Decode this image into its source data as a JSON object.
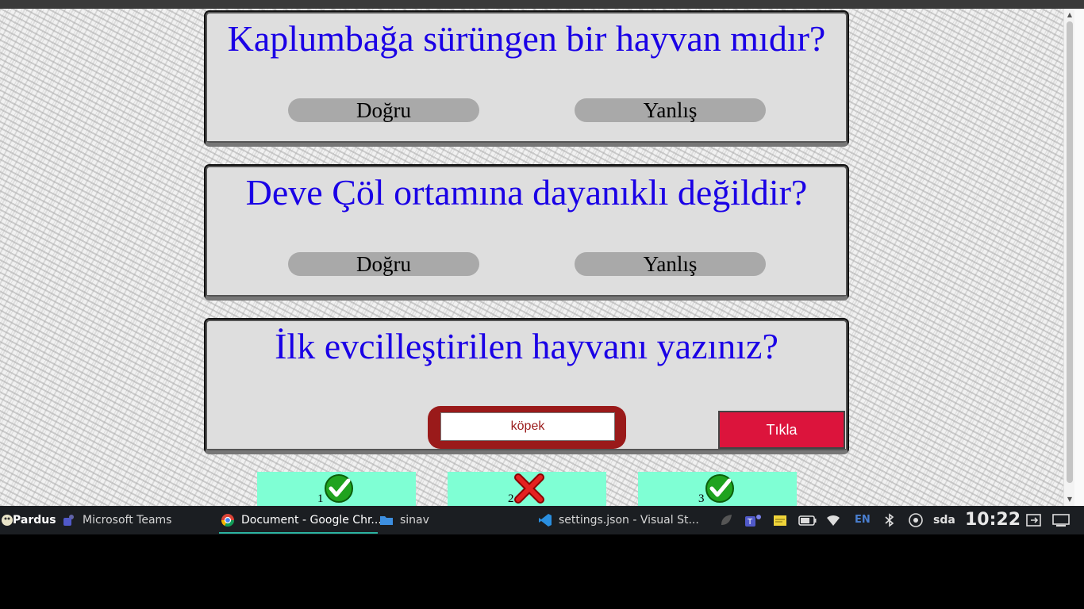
{
  "questions": [
    {
      "text": "Kaplumbağa sürüngen bir hayvan mıdır?",
      "true_label": "Doğru",
      "false_label": "Yanlış"
    },
    {
      "text": "Deve Çöl ortamına dayanıklı değildir?",
      "true_label": "Doğru",
      "false_label": "Yanlış"
    },
    {
      "text": "İlk evcilleştirilen hayvanı yazınız?",
      "answer_value": "köpek",
      "submit_label": "Tıkla"
    }
  ],
  "results": [
    {
      "number": "1",
      "icon": "check-icon",
      "status": "correct"
    },
    {
      "number": "2",
      "icon": "cross-icon",
      "status": "wrong"
    },
    {
      "number": "3",
      "icon": "check-icon",
      "status": "correct"
    }
  ],
  "colors": {
    "question_text": "#1a00e6",
    "card_bg": "#dedede",
    "answer_button": "#a9a9a9",
    "input_frame": "#9a1a1a",
    "submit_button": "#dc143c",
    "result_box": "#7fffd4"
  },
  "taskbar": {
    "start_label": "Pardus",
    "apps": [
      {
        "label": "Microsoft Teams",
        "icon": "teams-icon"
      },
      {
        "label": "Document - Google Chr...",
        "icon": "chrome-icon",
        "active": true
      },
      {
        "label": "sinav",
        "icon": "folder-icon"
      },
      {
        "label": "settings.json - Visual St...",
        "icon": "vscode-icon"
      }
    ],
    "tray": {
      "language": "EN",
      "drive": "sda",
      "time": "10:22"
    }
  }
}
